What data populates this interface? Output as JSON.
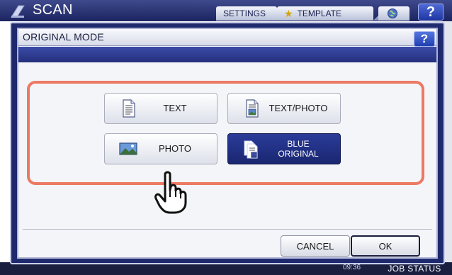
{
  "background": {
    "app_title": "SCAN",
    "settings_label": "SETTINGS",
    "template_label": "TEMPLATE",
    "help_label": "?",
    "time_label": "09:36",
    "job_status_label": "JOB STATUS"
  },
  "dialog": {
    "title": "ORIGINAL MODE",
    "help_label": "?",
    "options": [
      {
        "label": "TEXT",
        "icon": "text-document-icon",
        "selected": false
      },
      {
        "label": "TEXT/PHOTO",
        "icon": "text-photo-document-icon",
        "selected": false
      },
      {
        "label": "PHOTO",
        "icon": "photo-icon",
        "selected": false
      },
      {
        "label_line1": "BLUE",
        "label_line2": "ORIGINAL",
        "icon": "blue-original-icon",
        "selected": true
      }
    ],
    "cancel_label": "CANCEL",
    "ok_label": "OK"
  },
  "colors": {
    "header_navy": "#1c2461",
    "selected_button": "#1a2670",
    "highlight_border": "#ec7963",
    "dialog_band": "#2e3c93"
  }
}
